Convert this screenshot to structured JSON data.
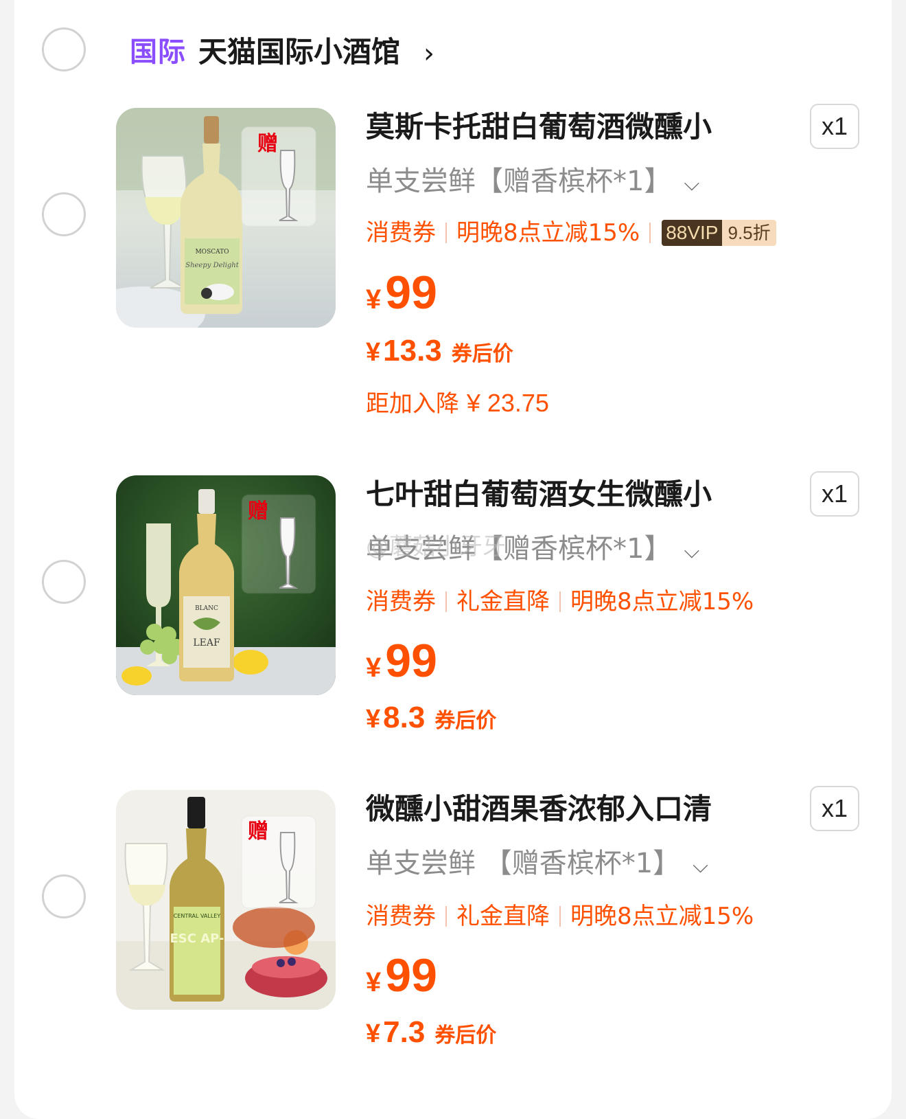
{
  "shop": {
    "badge": "国际",
    "name": "天猫国际小酒馆",
    "chevron": "›"
  },
  "items": [
    {
      "title": "莫斯卡托甜白葡萄酒微醺小",
      "qty": "x1",
      "sku": "单支尝鲜【赠香槟杯*1】",
      "tags": [
        "消费券",
        "明晚8点立减15%"
      ],
      "vip_label": "88VIP",
      "vip_discount": "9.5折",
      "gift_label": "赠",
      "price_currency": "¥",
      "price": "99",
      "after_currency": "¥",
      "after_price": "13.3",
      "after_label": "券后价",
      "reduce_label": "距加入降",
      "reduce_amount": "¥ 23.75",
      "bottle_label": "MOSCATO",
      "bottle_sub": "Sheepy Delight"
    },
    {
      "title": "七叶甜白葡萄酒女生微醺小",
      "qty": "x1",
      "sku": "单支尝鲜【赠香槟杯*1】",
      "tags": [
        "消费券",
        "礼金直降",
        "明晚8点立减15%"
      ],
      "gift_label": "赠",
      "price_currency": "¥",
      "price": "99",
      "after_currency": "¥",
      "after_price": "8.3",
      "after_label": "券后价",
      "bottle_label": "BLANC",
      "bottle_sub": "LEAF"
    },
    {
      "title": "微醺小甜酒果香浓郁入口清",
      "qty": "x1",
      "sku": "单支尝鲜 【赠香槟杯*1】",
      "tags": [
        "消费券",
        "礼金直降",
        "明晚8点立减15%"
      ],
      "gift_label": "赠",
      "price_currency": "¥",
      "price": "99",
      "after_currency": "¥",
      "after_price": "7.3",
      "after_label": "券后价",
      "bottle_label": "CENTRAL VALLEY",
      "bottle_sub": "ESC AP-"
    }
  ],
  "watermark": "@蘑菇小牙牙",
  "colors": {
    "accent": "#ff5000",
    "shop_badge": "#8a4dff",
    "muted": "#8c8c8c"
  }
}
